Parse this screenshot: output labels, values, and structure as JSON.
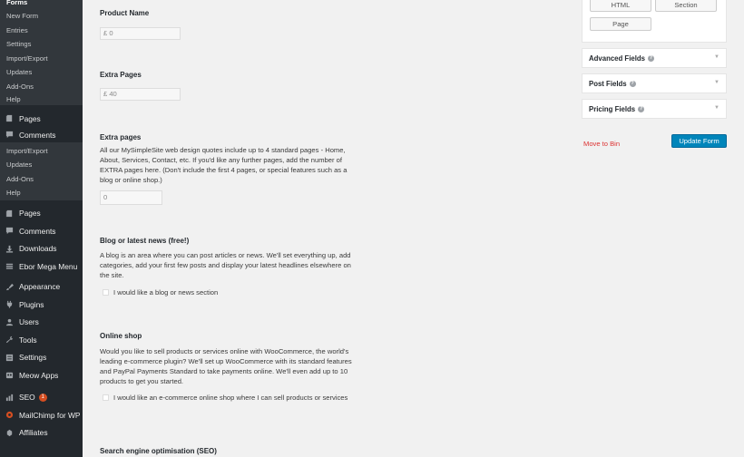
{
  "sidebar": {
    "sub1": {
      "header": "Forms",
      "items": [
        "New Form",
        "Entries",
        "Settings",
        "Import/Export",
        "Updates",
        "Add-Ons",
        "Help"
      ]
    },
    "flyout": [
      {
        "label": "Pages",
        "icon": "pages-icon"
      },
      {
        "label": "Comments",
        "icon": "comments-icon"
      }
    ],
    "sub2": {
      "items": [
        "Import/Export",
        "Updates",
        "Add-Ons",
        "Help"
      ]
    },
    "menu": [
      {
        "label": "Pages",
        "icon": "pages-icon"
      },
      {
        "label": "Comments",
        "icon": "comments-icon"
      },
      {
        "label": "Downloads",
        "icon": "downloads-icon"
      },
      {
        "label": "Ebor Mega Menu",
        "icon": "menu-icon"
      },
      {
        "label": "Appearance",
        "icon": "appearance-icon"
      },
      {
        "label": "Plugins",
        "icon": "plugins-icon"
      },
      {
        "label": "Users",
        "icon": "users-icon"
      },
      {
        "label": "Tools",
        "icon": "tools-icon"
      },
      {
        "label": "Settings",
        "icon": "settings-icon"
      },
      {
        "label": "Meow Apps",
        "icon": "meow-apps-icon"
      },
      {
        "label": "SEO",
        "icon": "seo-icon",
        "badge": "1"
      },
      {
        "label": "MailChimp for WP",
        "icon": "mailchimp-icon"
      },
      {
        "label": "Affiliates",
        "icon": "affiliates-icon"
      }
    ],
    "colors": {
      "bg": "#23282d",
      "submenu_bg": "#32373c",
      "active": "#0073aa",
      "badge": "#d54e21"
    }
  },
  "form": {
    "product_name": {
      "label": "Product Name",
      "value": "£ 0"
    },
    "extra_pages_price": {
      "label": "Extra Pages",
      "value": "£ 40"
    },
    "extra_pages": {
      "label": "Extra pages",
      "description": "All our MySimpleSite web design quotes include up to 4 standard pages - Home, About, Services, Contact, etc. If you'd like any further pages, add the number of EXTRA pages here. (Don't include the first 4 pages, or special features such as a blog or online shop.)",
      "value": "0"
    },
    "blog": {
      "label": "Blog or latest news (free!)",
      "description": "A blog is an area where you can post articles or news. We'll set everything up, add categories, add your first few posts and display your latest headlines elsewhere on the site.",
      "checkbox_label": "I would like a blog or news section"
    },
    "shop": {
      "label": "Online shop",
      "description": "Would you like to sell products or services online with WooCommerce, the world's leading e-commerce plugin? We'll set up WooCommerce with its standard features and PayPal Payments Standard to take payments online. We'll even add up to 10 products to get you started.",
      "checkbox_label": "I would like an e-commerce online shop where I can sell products or services"
    },
    "seo": {
      "label": "Search engine optimisation (SEO)"
    }
  },
  "right_panel": {
    "buttons": {
      "html": "HTML",
      "section": "Section",
      "page": "Page"
    },
    "accordions": [
      {
        "label": "Advanced Fields"
      },
      {
        "label": "Post Fields"
      },
      {
        "label": "Pricing Fields"
      }
    ],
    "help_glyph": "?",
    "move_to_bin": "Move to Bin",
    "update_form": "Update Form",
    "colors": {
      "primary": "#0085ba",
      "danger": "#dc3232"
    }
  }
}
